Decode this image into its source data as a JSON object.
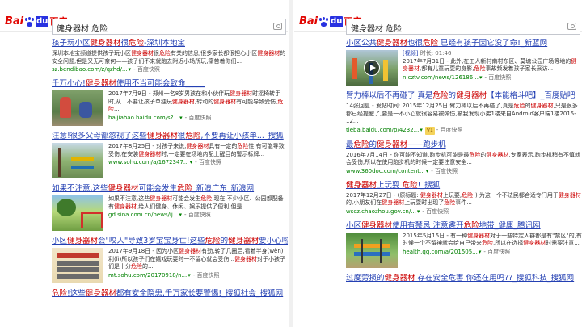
{
  "logo": {
    "bai": "Bai",
    "du": "du",
    "cn": "百度"
  },
  "search": {
    "query": "健身器材 危险"
  },
  "left": {
    "results": [
      {
        "title": "孩子玩小区健身器材很危险-深圳本地宝",
        "abstract": "深圳本地宝频道提供孩子玩小区健身器材很危险有关的信息,很多家长都很担心小区健身器材的安全问题,但是又无可奈何——孩子们不来就跑去附近小场所玩,痛苦着你们...",
        "url": "sz.bendibao.com/z/qzhd/...",
        "snapshot": "百度快照",
        "thumb": "none"
      },
      {
        "title": "千万小心!健身器材使用不当可能会致命_____",
        "abstract": "2017年7月9日 - 郑州一名8岁男孩在和小伙伴玩健身器材时摇椅转手时,从...不要让孩子单独玩健身器材,转动的健身器材有可能导致受伤,危险...",
        "url": "baijiahao.baidu.com/s?...",
        "snapshot": "百度快照",
        "thumb": "kids"
      },
      {
        "title": "注意!很多父母都忽视了这些健身器材很危险,不要再让小孩单..._搜狐",
        "abstract": "2017年8月25日 - 对孩子来说,健身器材具有一定的危险性,有可能导致受伤,在安装健身器材时,一定要在场地内配上醒目的警示标牌...",
        "url": "www.sohu.com/a/1672347...",
        "snapshot": "百度快照",
        "thumb": "yard"
      },
      {
        "title": "如果不注意,这些健身器材可能会发生危险_新浪广东_新浪网",
        "abstract": "如果不注意,这些健身器材可能会发生危险,现在,不少小区、公园都配备有健身器材,给人们健身、休闲、娱乐提供了便利,但是...",
        "url": "gd.sina.com.cn/news/ij...",
        "snapshot": "百度快照",
        "thumb": "park"
      },
      {
        "title": "小区健身器材会\"咬人\"导致3岁宝宝身亡!这些危险的健身器材要小心啦!",
        "abstract": "2017年9月18日 - 因为小区健身器材有劲,转了几圈后,看着半身(wèn)利(lì)所以孩子们在嬉戏玩耍时一不留心就会受伤...健身器材对于小孩子们是十分危险的...",
        "url": "mt.sohu.com/20170918/n...",
        "snapshot": "百度快照",
        "thumb": "sign"
      },
      {
        "title": "危险!这些健身器材都有安全隐患,千万家长要警惕!_搜狐社会_搜狐网",
        "abstract": "",
        "url": "",
        "snapshot": "",
        "thumb": "none"
      }
    ]
  },
  "right": {
    "results": [
      {
        "title": "小区公共健身器材也很危险 已经有孩子因它没了命!_新蓝网",
        "badge": "[视频]",
        "duration": "时长: 01:46",
        "abstract": "2017年7月31日 - 此外,在工人新村南村东区、莫塘公园广场等地的健身器材,都有儿童玩耍的身影,危险事故频发着孩子家长采访...",
        "url": "n.cztv.com/news/126186...",
        "snapshot": "百度快照",
        "thumb": "video"
      },
      {
        "title": "臂力棒以后不再碰了 真是危险的健身器材【本能格斗吧】_百度贴吧",
        "abstract": "14张回复 - 发帖时间: 2015年12月25日\n臂力棒以后不再碰了,真是危险的健身器材,只是很多都已经提醒了,要是一不小心就很容易被弹伤,被我发现小弟1楼来自Android客户端1楼2015-12...",
        "url": "tieba.baidu.com/p/4232...",
        "snapshot": "百度快照",
        "tag": "V1",
        "thumb": "none"
      },
      {
        "title": "最危险的健身器材——跑步机",
        "abstract": "2016年7月14日 - 你可能不知道,跑步机可能是最危险的健身器材,专家表示,跑步机稍有不慎就会受伤,所以在使用跑步机的时候一定要注意安全...",
        "url": "www.360doc.com/content...",
        "snapshot": "百度快照",
        "thumb": "none"
      },
      {
        "title": "健身器材上玩耍 危险!_搜狐",
        "abstract": "2017年12月27日 - (原标题: 健身器材上玩耍,危险!) 为这一个不法民都合适专门用于健身器材的,小朋友们在健身器材上玩耍时出现了危险事件...",
        "url": "wscz.chaozhou.gov.cn/...",
        "snapshot": "百度快照",
        "thumb": "none"
      },
      {
        "title": "小区健身器材使用有禁忌 注意避开危险地带_健康_腾讯网",
        "abstract": "2015年5月15日 - 有一种健身器材对于一些特定人群都是有\"禁区\"的,有时候一个不留神就会给自己带来危险,所以在选择健身器材时需要注意...",
        "url": "health.qq.com/a/201505...",
        "snapshot": "百度快照",
        "thumb": "run"
      },
      {
        "title": "过度劳损的健身器材 存在安全危害 你还在用吗??_搜狐科技_搜狐网",
        "abstract": "",
        "url": "",
        "snapshot": "",
        "thumb": "none"
      }
    ]
  },
  "colors": {
    "link": "#2440b3",
    "highlight": "#cc0000",
    "url": "#008000",
    "brand_red": "#e10602",
    "brand_blue": "#2932e1"
  }
}
